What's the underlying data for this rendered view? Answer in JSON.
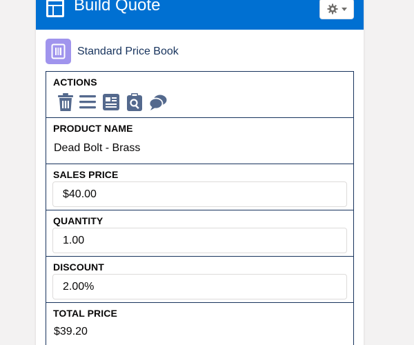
{
  "header": {
    "title": "Build Quote",
    "icon": "quote-layout-icon",
    "settings_icon": "gear-icon",
    "accent_color": "#0070d2"
  },
  "price_book": {
    "label": "Standard Price Book",
    "icon": "pricebook-icon",
    "icon_color": "#a094ed"
  },
  "actions": {
    "label": "ACTIONS",
    "icons": [
      "delete-icon",
      "list-icon",
      "details-icon",
      "search-product-icon",
      "chat-icon"
    ]
  },
  "product": {
    "label": "PRODUCT NAME",
    "value": "Dead Bolt - Brass"
  },
  "sales_price": {
    "label": "SALES PRICE",
    "value": "$40.00"
  },
  "quantity": {
    "label": "QUANTITY",
    "value": "1.00"
  },
  "discount": {
    "label": "DISCOUNT",
    "value": "2.00%"
  },
  "total_price": {
    "label": "TOTAL PRICE",
    "value": "$39.20"
  }
}
